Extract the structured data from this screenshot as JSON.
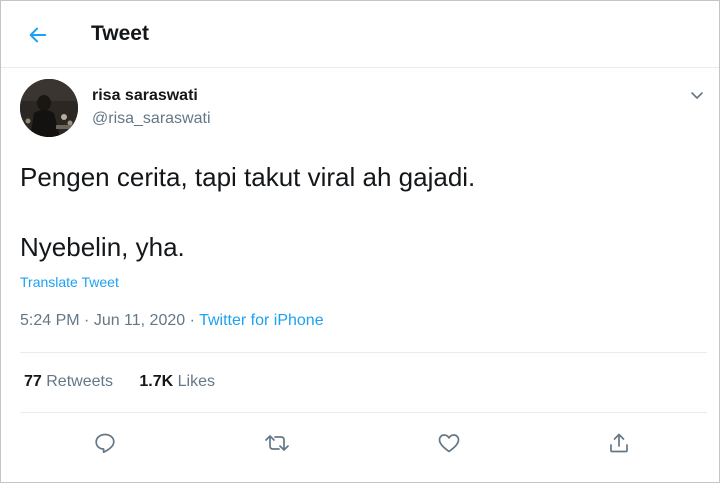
{
  "header": {
    "title": "Tweet",
    "back_icon": "arrow-left-icon",
    "accent_color": "#1da1f2"
  },
  "author": {
    "display_name": "risa saraswati",
    "handle": "@risa_saraswati"
  },
  "tweet": {
    "line1": "Pengen cerita, tapi takut viral ah gajadi.",
    "line2": "Nyebelin, yha.",
    "translate_label": "Translate Tweet",
    "time": "5:24 PM",
    "separator": " · ",
    "date": "Jun 11, 2020",
    "source": "Twitter for iPhone"
  },
  "stats": {
    "retweets_count": "77",
    "retweets_label": "Retweets",
    "likes_count": "1.7K",
    "likes_label": "Likes"
  },
  "actions": [
    "reply-icon",
    "retweet-icon",
    "like-icon",
    "share-icon"
  ],
  "colors": {
    "text": "#14171a",
    "secondary": "#657786",
    "link": "#1da1f2",
    "divider": "#e6ecf0"
  }
}
